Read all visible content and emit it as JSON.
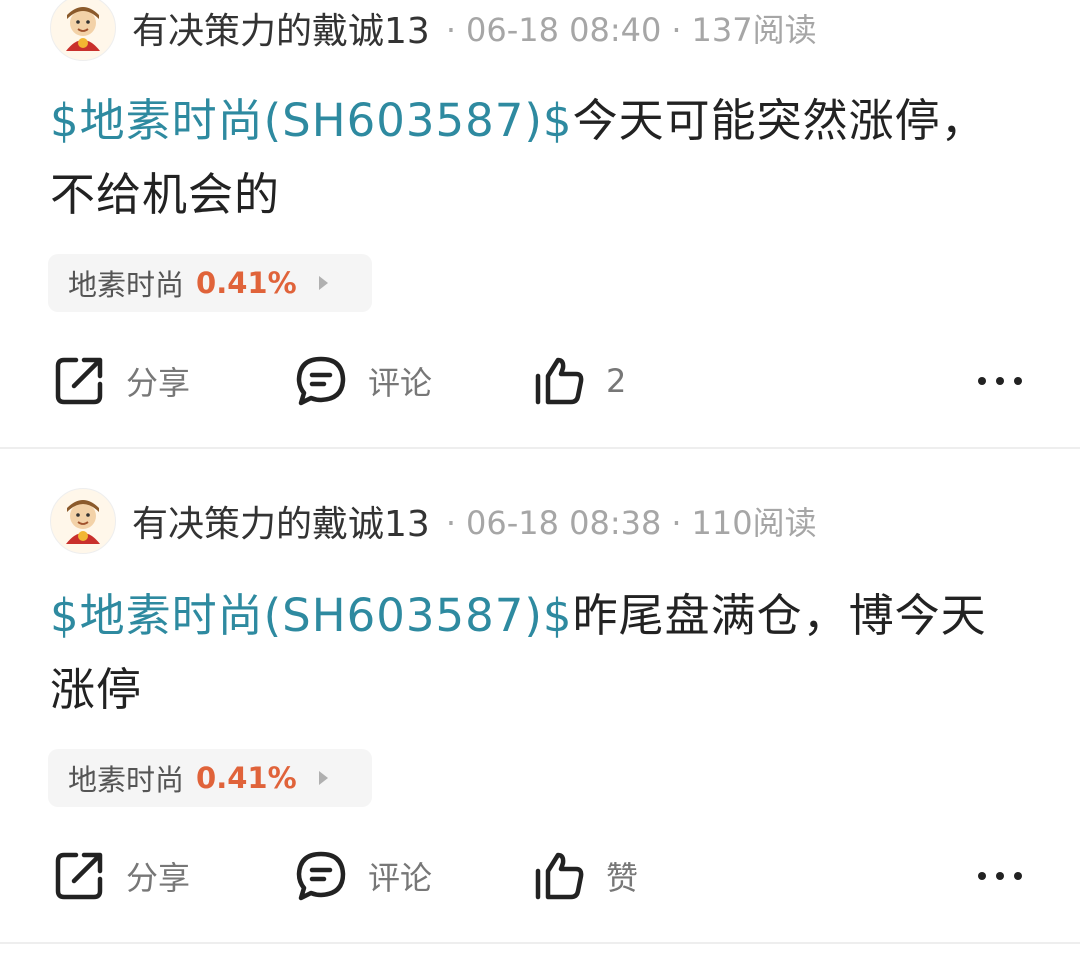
{
  "posts": [
    {
      "username": "有决策力的戴诚13",
      "time": "06-18 08:40",
      "reads": "137阅读",
      "stock_tag": "$地素时尚(SH603587)$",
      "text": "今天可能突然涨停，不给机会的",
      "chip_name": "地素时尚",
      "chip_change": "0.41%",
      "share_label": "分享",
      "comment_label": "评论",
      "like_label": "2"
    },
    {
      "username": "有决策力的戴诚13",
      "time": "06-18 08:38",
      "reads": "110阅读",
      "stock_tag": "$地素时尚(SH603587)$",
      "text": "昨尾盘满仓，博今天涨停",
      "chip_name": "地素时尚",
      "chip_change": "0.41%",
      "share_label": "分享",
      "comment_label": "评论",
      "like_label": "赞"
    }
  ],
  "icons": {
    "avatar": "avatar-icon",
    "share": "share-icon",
    "comment": "comment-icon",
    "like": "thumbs-up-icon",
    "more": "more-icon",
    "chip_arrow": "chevron-right-icon"
  },
  "colors": {
    "stock_link": "#2e8aa0",
    "chip_change": "#e0633a",
    "meta": "#a6a6a6"
  }
}
